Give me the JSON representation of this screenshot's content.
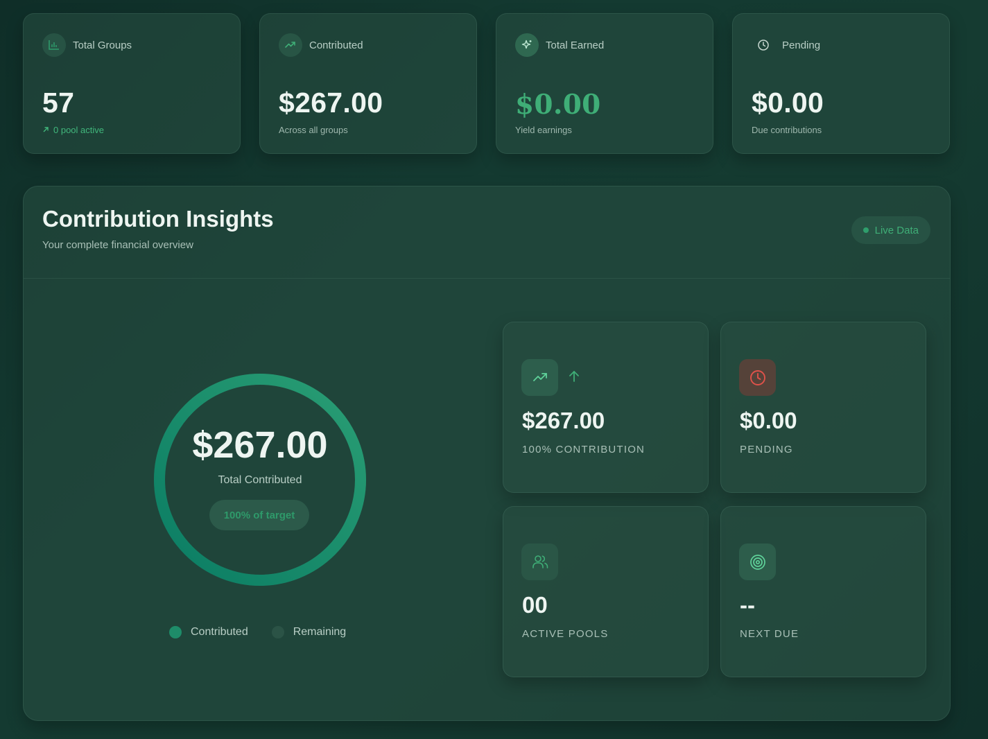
{
  "stats": [
    {
      "label": "Total Groups",
      "value": "57",
      "sub": "0 pool active",
      "icon": "bar-chart-icon"
    },
    {
      "label": "Contributed",
      "value": "$267.00",
      "sub": "Across all groups",
      "icon": "trending-up-icon"
    },
    {
      "label": "Total Earned",
      "value": "$0.00",
      "sub": "Yield earnings",
      "icon": "sparkles-icon"
    },
    {
      "label": "Pending",
      "value": "$0.00",
      "sub": "Due contributions",
      "icon": "clock-icon"
    }
  ],
  "insights": {
    "title": "Contribution Insights",
    "subtitle": "Your complete financial overview",
    "live_label": "Live Data",
    "ring": {
      "amount": "$267.00",
      "label": "Total Contributed",
      "pill": "100% of target",
      "progress": 1.0
    },
    "legend": [
      {
        "label": "Contributed",
        "color": "#1e8c69"
      },
      {
        "label": "Remaining",
        "color": "#2b5346"
      }
    ],
    "tiles": [
      {
        "value": "$267.00",
        "label": "100% CONTRIBUTION",
        "icon": "trending-up-icon"
      },
      {
        "value": "$0.00",
        "label": "PENDING",
        "icon": "clock-icon"
      },
      {
        "value": "00",
        "label": "ACTIVE POOLS",
        "icon": "users-icon"
      },
      {
        "value": "--",
        "label": "NEXT DUE",
        "icon": "target-icon"
      }
    ]
  },
  "colors": {
    "accent": "#2f9e6c",
    "accent_light": "#41b77c",
    "danger": "#e0524a"
  }
}
